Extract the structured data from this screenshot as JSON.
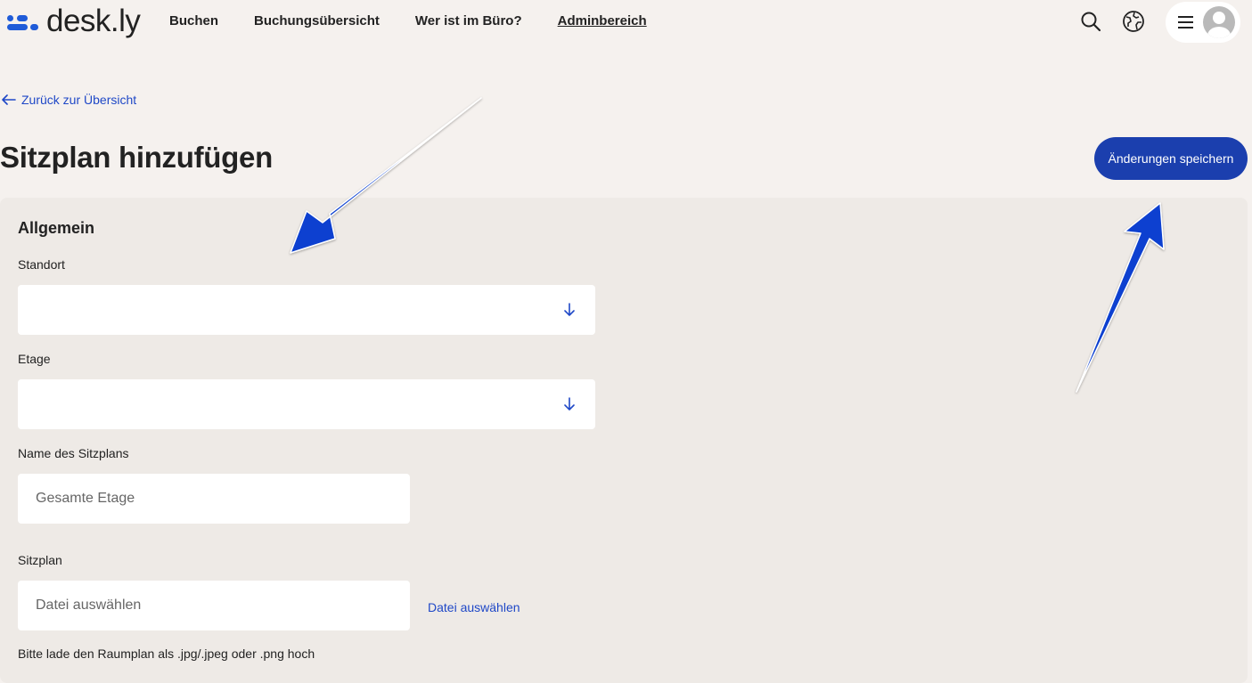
{
  "brand": {
    "name": "desk.ly",
    "accent": "#1f5bd8",
    "primary_button": "#1b3fae",
    "link_color": "#1f48c7"
  },
  "nav": {
    "items": [
      {
        "label": "Buchen"
      },
      {
        "label": "Buchungsübersicht"
      },
      {
        "label": "Wer ist im Büro?"
      },
      {
        "label": "Adminbereich",
        "active": true
      }
    ],
    "icons": [
      "search-icon",
      "globe-icon",
      "hamburger-menu-icon",
      "avatar-icon"
    ]
  },
  "back_link": {
    "label": "Zurück zur Übersicht"
  },
  "page": {
    "title": "Sitzplan hinzufügen",
    "save_label": "Änderungen speichern"
  },
  "form": {
    "section_title": "Allgemein",
    "location": {
      "label": "Standort",
      "value": ""
    },
    "floor": {
      "label": "Etage",
      "value": ""
    },
    "plan_name": {
      "label": "Name des Sitzplans",
      "placeholder": "Gesamte Etage"
    },
    "seat_plan": {
      "label": "Sitzplan",
      "placeholder": "Datei auswählen",
      "link_label": "Datei auswählen",
      "hint": "Bitte lade den Raumplan als .jpg/.jpeg oder .png hoch"
    }
  },
  "annotations": {
    "arrow_color": "#0b3fd0"
  }
}
